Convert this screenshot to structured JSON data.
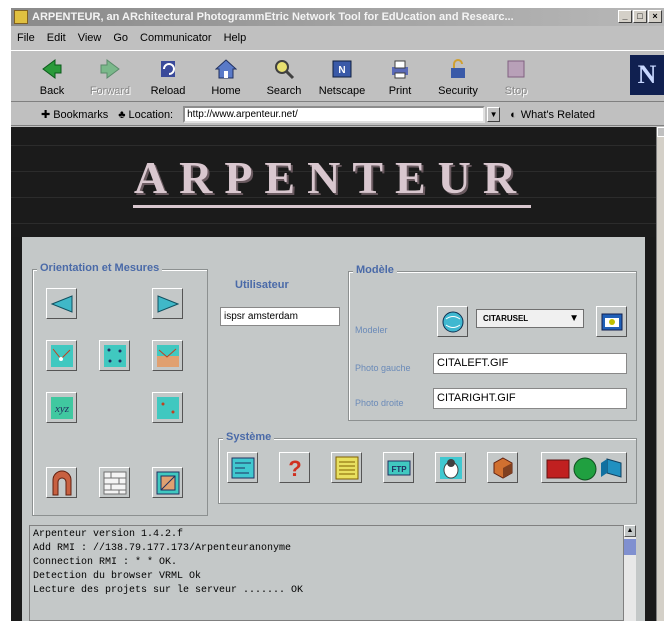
{
  "window": {
    "title": "ARPENTEUR, an ARchitectural PhotogrammEtric Network Tool for EdUcation and Researc..."
  },
  "menu": [
    "File",
    "Edit",
    "View",
    "Go",
    "Communicator",
    "Help"
  ],
  "toolbar": {
    "back": "Back",
    "forward": "Forward",
    "reload": "Reload",
    "home": "Home",
    "search": "Search",
    "netscape": "Netscape",
    "print": "Print",
    "security": "Security",
    "stop": "Stop"
  },
  "location": {
    "bookmarks": "Bookmarks",
    "label": "Location:",
    "url": "http://www.arpenteur.net/",
    "related": "What's Related"
  },
  "banner": {
    "title": "ARPENTEUR"
  },
  "orientation": {
    "label": "Orientation et Mesures"
  },
  "utilisateur": {
    "label": "Utilisateur",
    "value": "ispsr amsterdam"
  },
  "modele": {
    "label": "Modèle",
    "modeler_label": "Modeler",
    "modeler_value": "CITARUSEL",
    "photo_gauche_label": "Photo gauche",
    "photo_gauche_value": "CITALEFT.GIF",
    "photo_droite_label": "Photo droite",
    "photo_droite_value": "CITARIGHT.GIF"
  },
  "systeme": {
    "label": "Système"
  },
  "log": {
    "lines": [
      "Arpenteur version 1.4.2.f",
      "Add RMI : //138.79.177.173/Arpenteuranonyme",
      "Connection RMI :  * * OK.",
      "Detection du browser VRML Ok",
      "Lecture des projets sur le serveur ....... OK"
    ]
  },
  "colors": {
    "banner_bg": "#1b1b1b",
    "banner_text": "#d9c7cf",
    "panel_bg": "#c4c8c8",
    "group_label": "#4a6aa8"
  }
}
